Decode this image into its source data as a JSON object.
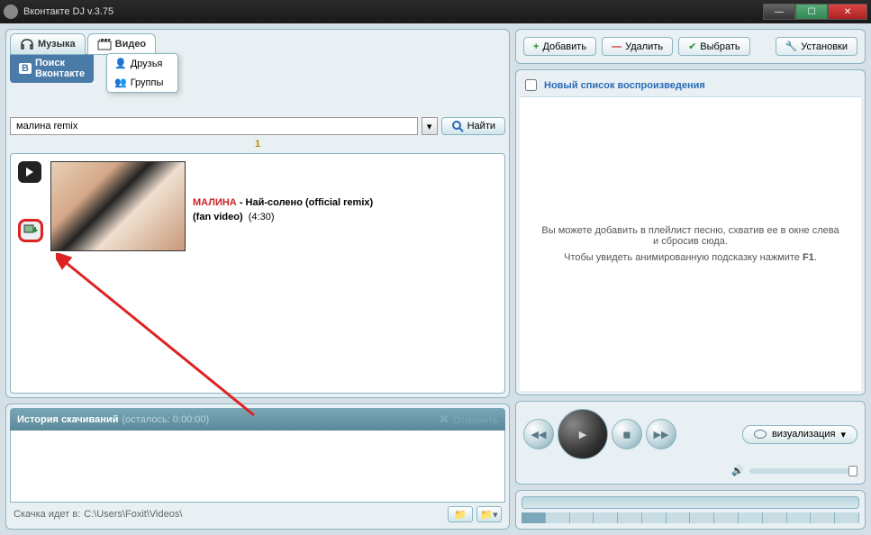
{
  "window": {
    "title": "Вконтакте DJ v.3.75"
  },
  "tabs": {
    "music": "Музыка",
    "video": "Видео",
    "search_vk": "Поиск\nВконтакте"
  },
  "video_menu": {
    "friends": "Друзья",
    "groups": "Группы"
  },
  "search": {
    "value": "малина remix",
    "find": "Найти"
  },
  "pager": {
    "page": "1"
  },
  "result": {
    "artist": "МАЛИНА",
    "title_sep": " - Най-солено (official remix)",
    "subtitle": "(fan video)",
    "duration": "(4:30)"
  },
  "history": {
    "title": "История скачиваний",
    "remaining": "(осталось: 0:00:00)",
    "cancel": "Отменить",
    "footer_prefix": "Скачка идет в:",
    "footer_path": "C:\\Users\\Foxit\\Videos\\"
  },
  "right_buttons": {
    "add": "Добавить",
    "delete": "Удалить",
    "select": "Выбрать",
    "settings": "Установки"
  },
  "playlist": {
    "title": "Новый список воспроизведения",
    "hint1": "Вы можете добавить в плейлист песню, схватив ее в окне слева и сбросив сюда.",
    "hint2_a": "Чтобы увидеть анимированную подсказку нажмите ",
    "hint2_b": "F1",
    "hint2_c": "."
  },
  "player": {
    "viz": "визуализация"
  }
}
